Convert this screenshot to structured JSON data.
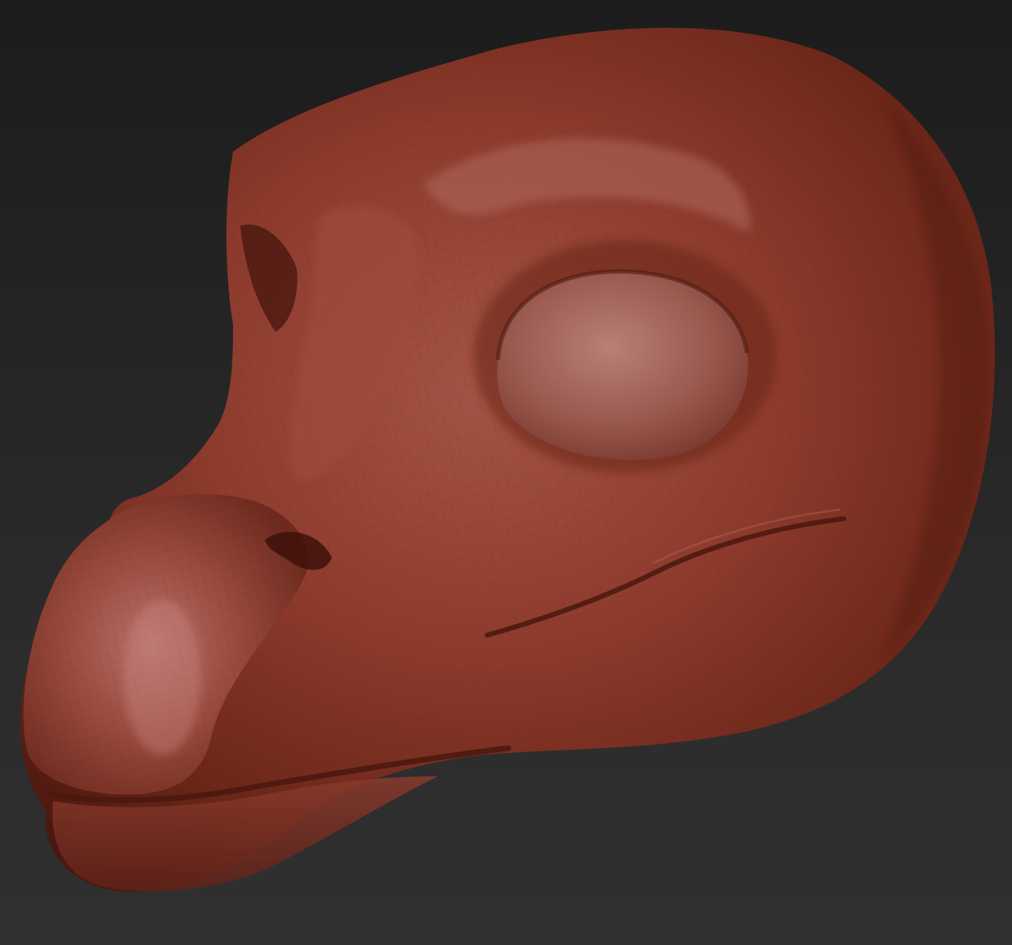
{
  "scene": {
    "background_top": "#1c1c1c",
    "background_bottom": "#303030",
    "model_color": "#8a3a2c",
    "model_highlight": "#c07a70",
    "model_shadow": "#5a2016",
    "wireframe_color": "#6e2a20"
  }
}
